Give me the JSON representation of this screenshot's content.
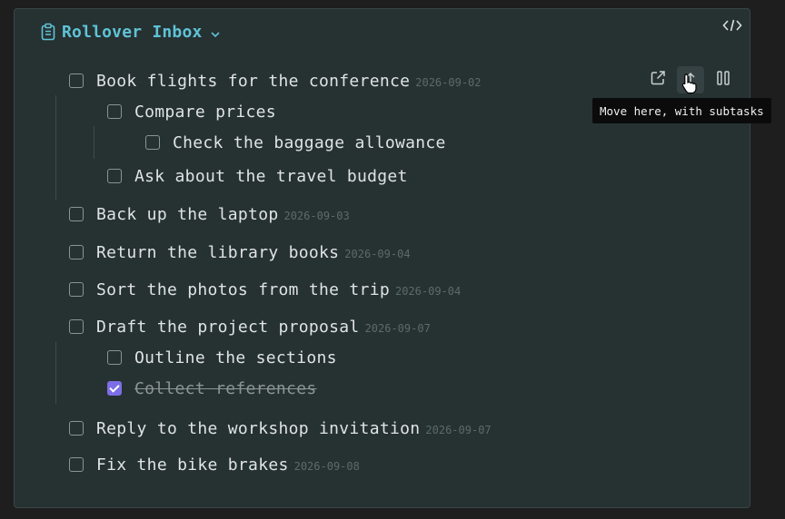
{
  "header": {
    "title": "Rollover Inbox",
    "title_icon": "clipboard-icon",
    "dropdown_icon": "chevron-down-icon",
    "code_icon": "code-icon"
  },
  "colors": {
    "accent": "#5fc3d6",
    "checkbox_checked": "#7c6ee6",
    "panel_bg": "#263132"
  },
  "tasks": [
    {
      "label": "Book flights for the conference",
      "date": "2026-09-02",
      "checked": false,
      "level": 0
    },
    {
      "label": "Compare prices",
      "date": "",
      "checked": false,
      "level": 1
    },
    {
      "label": "Check the baggage allowance",
      "date": "",
      "checked": false,
      "level": 2
    },
    {
      "label": "Ask about the travel budget",
      "date": "",
      "checked": false,
      "level": 1
    },
    {
      "label": "Back up the laptop",
      "date": "2026-09-03",
      "checked": false,
      "level": 0
    },
    {
      "label": "Return the library books",
      "date": "2026-09-04",
      "checked": false,
      "level": 0
    },
    {
      "label": "Sort the photos from the trip",
      "date": "2026-09-04",
      "checked": false,
      "level": 0
    },
    {
      "label": "Draft the project proposal",
      "date": "2026-09-07",
      "checked": false,
      "level": 0
    },
    {
      "label": "Outline the sections",
      "date": "",
      "checked": false,
      "level": 1
    },
    {
      "label": "Collect references",
      "date": "",
      "checked": true,
      "level": 1
    },
    {
      "label": "Reply to the workshop invitation",
      "date": "2026-09-07",
      "checked": false,
      "level": 0
    },
    {
      "label": "Fix the bike brakes",
      "date": "2026-09-08",
      "checked": false,
      "level": 0
    }
  ],
  "row_actions": {
    "open_icon": "external-link-icon",
    "move_icon": "move-up-arrow-icon",
    "pause_icon": "pause-icon"
  },
  "tooltip": {
    "text": "Move here, with subtasks"
  }
}
